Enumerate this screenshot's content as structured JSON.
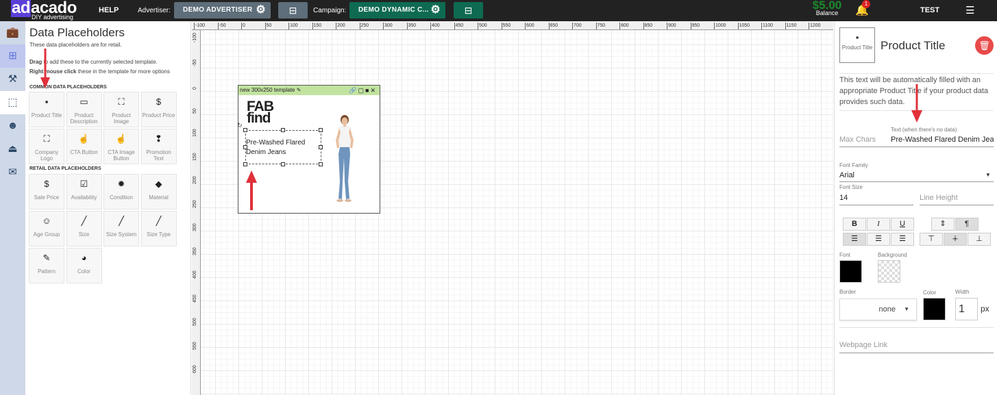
{
  "topbar": {
    "logo_highlight": "ad",
    "logo_rest": "acado",
    "logo_sub": "DIY advertising",
    "help": "HELP",
    "advertiser_label": "Advertiser:",
    "advertiser_value": "DEMO ADVERTISER",
    "campaign_label": "Campaign:",
    "campaign_value": "DEMO DYNAMIC C...",
    "balance_amount": "$5.00",
    "balance_label": "Balance",
    "notifications_count": "1",
    "user": "TEST",
    "accent": "#5b3fd8",
    "advertiser_color": "#5e6e7a",
    "campaign_color": "#0e6b52"
  },
  "left_icons": [
    {
      "name": "briefcase-icon",
      "glyph": "💼"
    },
    {
      "name": "add-layer-icon",
      "glyph": "⊞"
    },
    {
      "name": "tools-icon",
      "glyph": "⚒"
    },
    {
      "name": "data-placeholder-icon",
      "glyph": "⬚"
    },
    {
      "name": "emoji-icon",
      "glyph": "☻"
    },
    {
      "name": "stamp-icon",
      "glyph": "⏏"
    },
    {
      "name": "twitter-icon",
      "glyph": "✉"
    }
  ],
  "panel": {
    "title": "Data Placeholders",
    "subtitle": "These data placeholders are for retail.",
    "help_drag_bold": "Drag",
    "help_drag_rest": " to add these to the currently selected template.",
    "help_right_bold": "Right mouse click",
    "help_right_rest": " these in the template for more options",
    "common_header": "COMMON DATA PLACEHOLDERS",
    "retail_header": "RETAIL DATA PLACEHOLDERS",
    "common": [
      {
        "label": "Product Title",
        "icon": "▪",
        "icon_name": "product-title-icon"
      },
      {
        "label": "Product Description",
        "icon": "▭",
        "icon_name": "product-description-icon"
      },
      {
        "label": "Product Image",
        "icon": "⛶",
        "icon_name": "product-image-icon"
      },
      {
        "label": "Product Price",
        "icon": "$",
        "icon_name": "product-price-icon"
      },
      {
        "label": "Company Logo",
        "icon": "⛶",
        "icon_name": "company-logo-icon"
      },
      {
        "label": "CTA Button",
        "icon": "☝",
        "icon_name": "cta-button-icon"
      },
      {
        "label": "CTA Image Button",
        "icon": "☝",
        "icon_name": "cta-image-button-icon"
      },
      {
        "label": "Promotion Text",
        "icon": "❢",
        "icon_name": "promotion-text-icon"
      }
    ],
    "retail": [
      {
        "label": "Sale Price",
        "icon": "$",
        "icon_name": "sale-price-icon"
      },
      {
        "label": "Availability",
        "icon": "☑",
        "icon_name": "availability-icon"
      },
      {
        "label": "Condition",
        "icon": "✹",
        "icon_name": "condition-icon"
      },
      {
        "label": "Material",
        "icon": "◆",
        "icon_name": "material-icon"
      },
      {
        "label": "Age Group",
        "icon": "☺",
        "icon_name": "age-group-icon"
      },
      {
        "label": "Size",
        "icon": "╱",
        "icon_name": "size-icon"
      },
      {
        "label": "Size System",
        "icon": "╱",
        "icon_name": "size-system-icon"
      },
      {
        "label": "Size Type",
        "icon": "╱",
        "icon_name": "size-type-icon"
      },
      {
        "label": "Pattern",
        "icon": "✎",
        "icon_name": "pattern-icon"
      },
      {
        "label": "Color",
        "icon": "◕",
        "icon_name": "color-icon"
      }
    ]
  },
  "ruler": {
    "top": [
      "-100",
      "-50",
      "0",
      "50",
      "100",
      "150",
      "200",
      "250",
      "300",
      "350",
      "400",
      "450",
      "500",
      "550",
      "600",
      "650",
      "700",
      "750",
      "800",
      "850",
      "900",
      "950",
      "1000",
      "1050",
      "1100",
      "1150",
      "1200"
    ],
    "left": [
      "-100",
      "-50",
      "0",
      "50",
      "100",
      "150",
      "200",
      "250",
      "300",
      "350",
      "400",
      "450",
      "500",
      "550",
      "600"
    ]
  },
  "template": {
    "name": "new 300x250 template",
    "brand_line1": "FAB",
    "brand_line2": "find",
    "text": "Pre-Washed Flared Denim Jeans"
  },
  "props": {
    "tile_label": "Product Title",
    "title": "Product Title",
    "description": "This text will be automatically filled with an appropriate Product Title if your product data provides such data.",
    "max_chars_placeholder": "Max Chars",
    "nodata_label": "Text (when there's no data)",
    "nodata_value": "Pre-Washed Flared Denim Jeans",
    "font_family_label": "Font Family",
    "font_family_value": "Arial",
    "font_size_label": "Font Size",
    "font_size_value": "14",
    "line_height_placeholder": "Line Height",
    "font_color_label": "Font",
    "background_label": "Background",
    "border_label": "Border",
    "border_value": "none",
    "color_label": "Color",
    "width_label": "Width",
    "width_value": "1",
    "width_unit": "px",
    "webpage_link_placeholder": "Webpage Link",
    "font_color": "#000000",
    "border_color": "#000000"
  }
}
